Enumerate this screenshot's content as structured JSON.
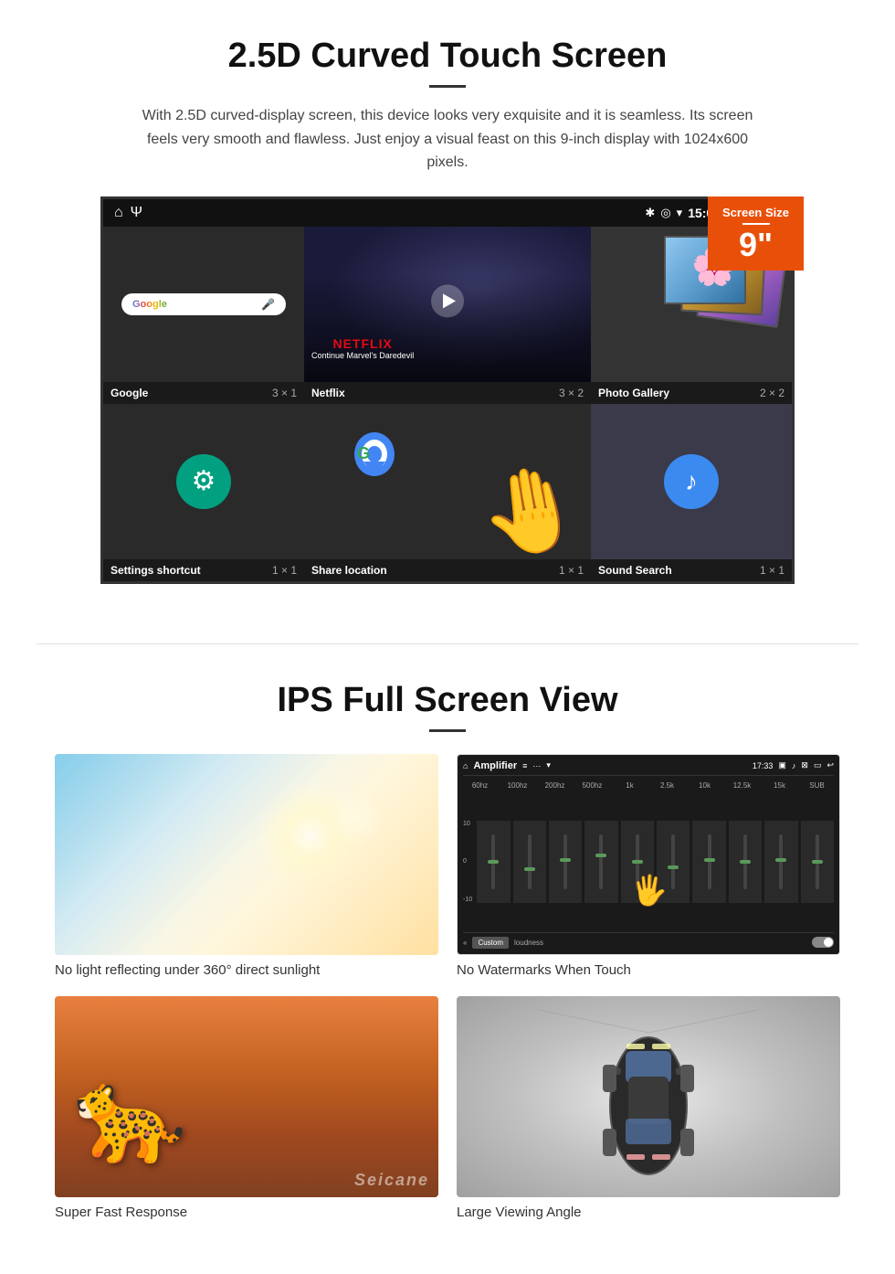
{
  "section1": {
    "title": "2.5D Curved Touch Screen",
    "description": "With 2.5D curved-display screen, this device looks very exquisite and it is seamless. Its screen feels very smooth and flawless. Just enjoy a visual feast on this 9-inch display with 1024x600 pixels.",
    "badge": {
      "title": "Screen Size",
      "size": "9\""
    },
    "statusBar": {
      "time": "15:06"
    },
    "apps": {
      "row1": [
        {
          "name": "Google",
          "size": "3 × 1"
        },
        {
          "name": "Netflix",
          "size": "3 × 2"
        },
        {
          "name": "Photo Gallery",
          "size": "2 × 2"
        }
      ],
      "row2": [
        {
          "name": "Settings shortcut",
          "size": "1 × 1"
        },
        {
          "name": "Share location",
          "size": "1 × 1"
        },
        {
          "name": "Sound Search",
          "size": "1 × 1"
        }
      ]
    },
    "netflix": {
      "logo": "NETFLIX",
      "subtitle": "Continue Marvel's Daredevil"
    },
    "watermark": "Seicane"
  },
  "section2": {
    "title": "IPS Full Screen View",
    "images": [
      {
        "id": "sunlight",
        "caption": "No light reflecting under 360° direct sunlight"
      },
      {
        "id": "amplifier",
        "caption": "No Watermarks When Touch",
        "header": {
          "title": "Amplifier",
          "time": "17:33"
        }
      },
      {
        "id": "cheetah",
        "caption": "Super Fast Response",
        "watermark": "Seicane"
      },
      {
        "id": "car",
        "caption": "Large Viewing Angle"
      }
    ]
  }
}
